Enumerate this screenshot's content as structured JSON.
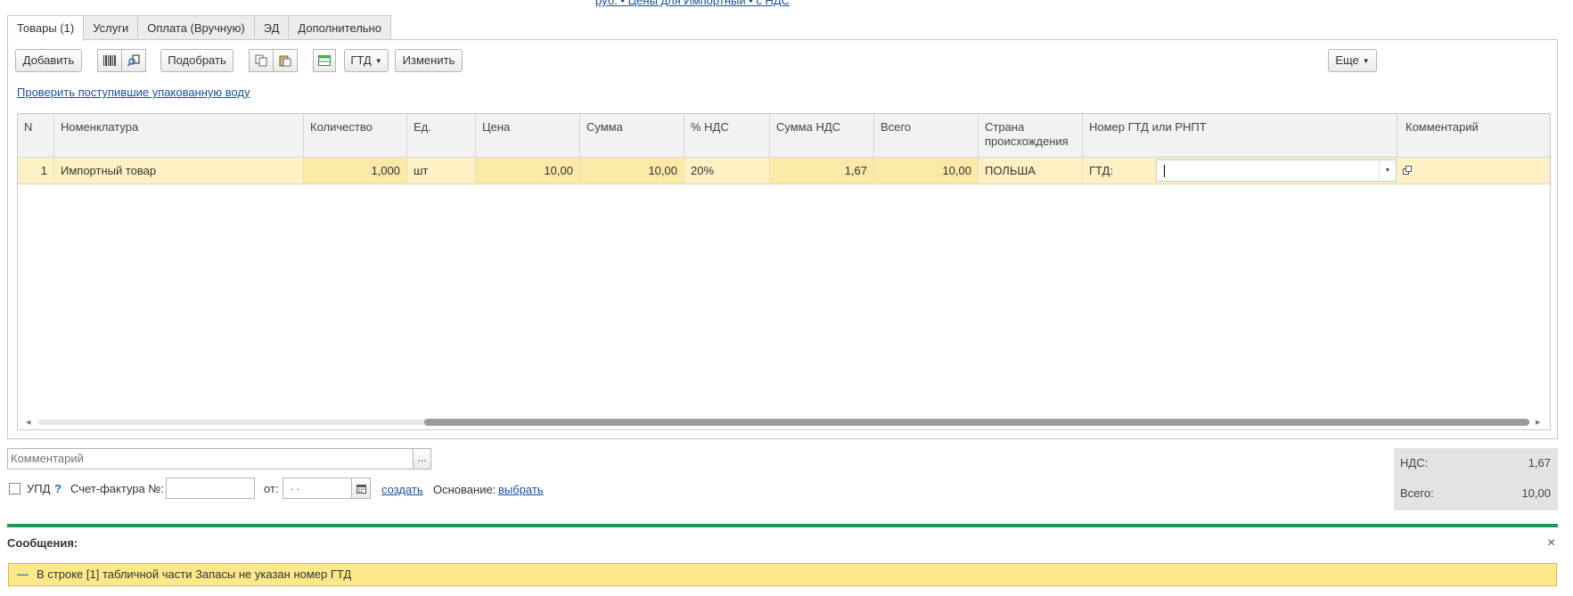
{
  "top_link": "руб. • Цены для Импортный • с НДС",
  "tabs": [
    {
      "label": "Товары (1)"
    },
    {
      "label": "Услуги"
    },
    {
      "label": "Оплата (Вручную)"
    },
    {
      "label": "ЭД"
    },
    {
      "label": "Дополнительно"
    }
  ],
  "toolbar": {
    "add_label": "Добавить",
    "pick_label": "Подобрать",
    "gtd_label": "ГТД",
    "change_label": "Изменить",
    "more_label": "Еще",
    "barcode_icon": "barcode-icon",
    "search_icon": "search-device-icon",
    "copy_icon": "copy-icon",
    "paste_icon": "paste-icon",
    "table_icon": "table-settings-icon"
  },
  "check_link": "Проверить поступившие упакованную воду",
  "table": {
    "headers": {
      "n": "N",
      "nomenclature": "Номенклатура",
      "qty": "Количество",
      "unit": "Ед.",
      "price": "Цена",
      "sum": "Сумма",
      "vat_pct": "% НДС",
      "vat_sum": "Сумма НДС",
      "total": "Всего",
      "country_1": "Страна",
      "country_2": "происхождения",
      "gtd": "Номер ГТД или РНПТ",
      "comment": "Комментарий"
    },
    "row": {
      "n": "1",
      "nomenclature": "Импортный товар",
      "qty": "1,000",
      "unit": "шт",
      "price": "10,00",
      "sum": "10,00",
      "vat_pct": "20%",
      "vat_sum": "1,67",
      "total": "10,00",
      "country": "ПОЛЬША",
      "gtd_prefix": "ГТД:",
      "gtd_value": "",
      "comment": ""
    }
  },
  "comment_field": {
    "placeholder": "Комментарий",
    "button": "..."
  },
  "invoice": {
    "upd_label": "УПД",
    "help": "?",
    "number_label": "Счет-фактура №:",
    "number_value": "",
    "date_label": "от:",
    "date_value": " .  .",
    "create_link": "создать",
    "basis_label": "Основание:",
    "basis_link": "выбрать"
  },
  "totals": {
    "vat_label": "НДС:",
    "vat_value": "1,67",
    "total_label": "Всего:",
    "total_value": "10,00"
  },
  "messages": {
    "title": "Сообщения:",
    "close": "×",
    "collapse": "—",
    "text": "В строке [1] табличной части Запасы не указан номер ГТД"
  },
  "colors": {
    "accent_green": "#1f9a55",
    "row_highlight": "#fdf1c4",
    "message_bg": "#fde98a",
    "link": "#1a4fa0"
  }
}
